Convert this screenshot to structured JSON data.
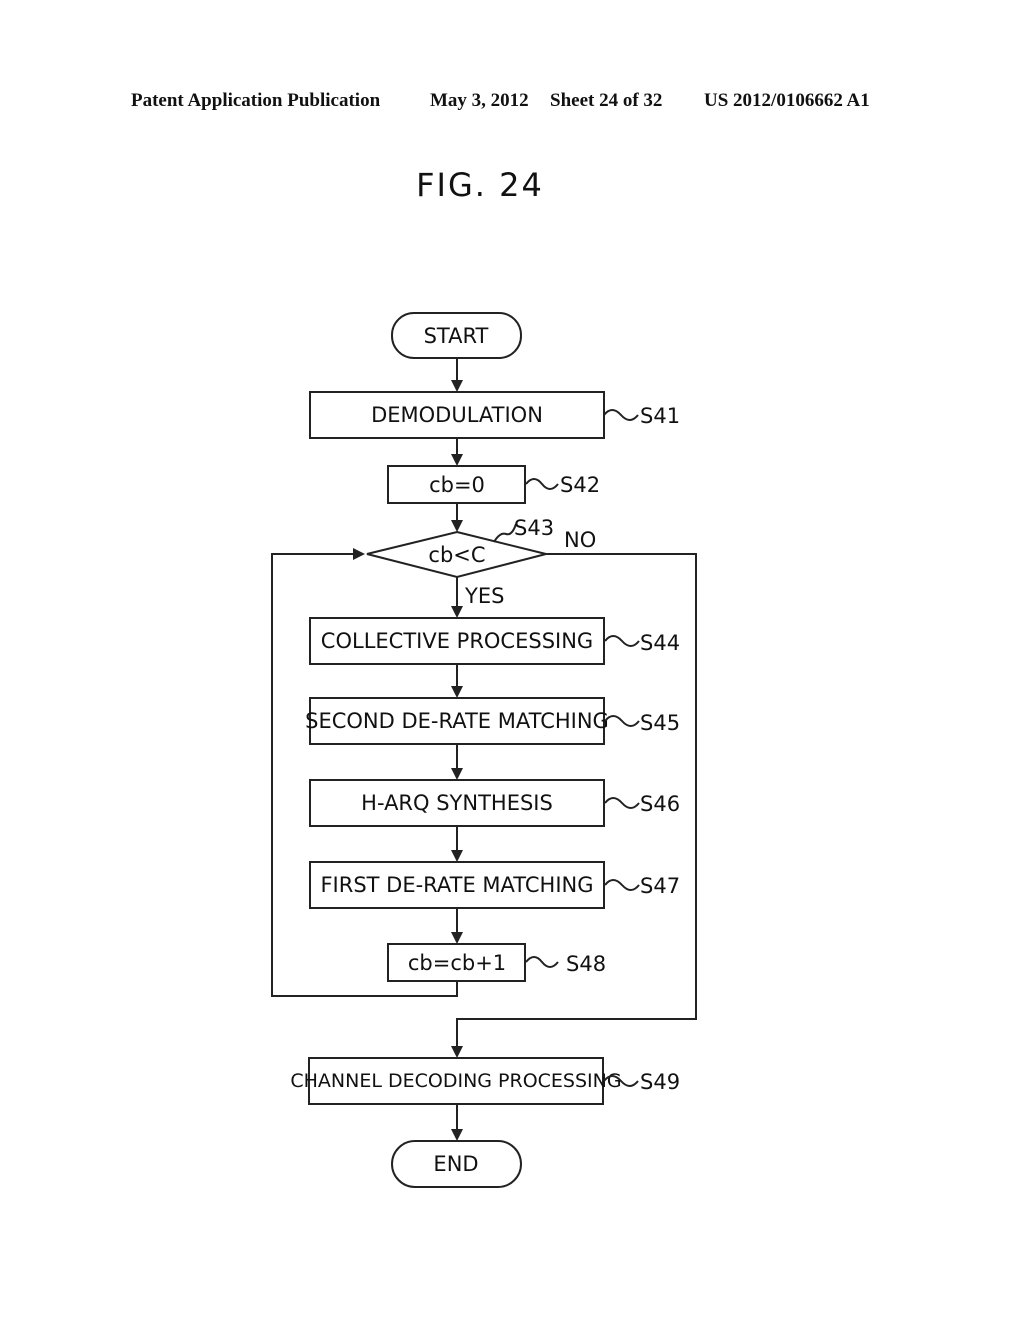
{
  "header": {
    "publication": "Patent Application Publication",
    "date": "May 3, 2012",
    "sheet": "Sheet 24 of 32",
    "number": "US 2012/0106662 A1"
  },
  "figure": {
    "title": "FIG. 24"
  },
  "flowchart": {
    "start": "START",
    "end": "END",
    "steps": [
      {
        "id": "S41",
        "text": "DEMODULATION"
      },
      {
        "id": "S42",
        "text": "cb=0"
      },
      {
        "id": "S43",
        "text": "cb<C",
        "type": "decision",
        "yes": "YES",
        "no": "NO"
      },
      {
        "id": "S44",
        "text": "COLLECTIVE PROCESSING"
      },
      {
        "id": "S45",
        "text": "SECOND DE-RATE MATCHING"
      },
      {
        "id": "S46",
        "text": "H-ARQ SYNTHESIS"
      },
      {
        "id": "S47",
        "text": "FIRST DE-RATE MATCHING"
      },
      {
        "id": "S48",
        "text": "cb=cb+1"
      },
      {
        "id": "S49",
        "text": "CHANNEL DECODING PROCESSING"
      }
    ]
  }
}
